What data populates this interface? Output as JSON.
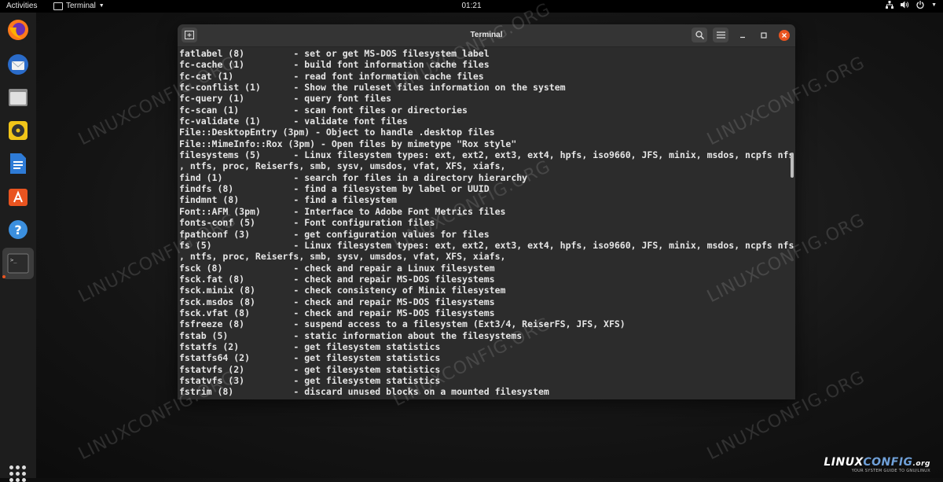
{
  "topbar": {
    "activities": "Activities",
    "app_menu": "Terminal",
    "clock": "01:21"
  },
  "dock": {
    "items": [
      "firefox-icon",
      "thunderbird-icon",
      "files-icon",
      "rhythmbox-icon",
      "writer-icon",
      "software-icon",
      "help-icon",
      "terminal-icon"
    ],
    "accent": "#e95420"
  },
  "window": {
    "title": "Terminal",
    "lines": [
      "fatlabel (8)         - set or get MS-DOS filesystem label",
      "fc-cache (1)         - build font information cache files",
      "fc-cat (1)           - read font information cache files",
      "fc-conflist (1)      - Show the ruleset files information on the system",
      "fc-query (1)         - query font files",
      "fc-scan (1)          - scan font files or directories",
      "fc-validate (1)      - validate font files",
      "File::DesktopEntry (3pm) - Object to handle .desktop files",
      "File::MimeInfo::Rox (3pm) - Open files by mimetype \"Rox style\"",
      "filesystems (5)      - Linux filesystem types: ext, ext2, ext3, ext4, hpfs, iso9660, JFS, minix, msdos, ncpfs nfs",
      ", ntfs, proc, Reiserfs, smb, sysv, umsdos, vfat, XFS, xiafs,",
      "find (1)             - search for files in a directory hierarchy",
      "findfs (8)           - find a filesystem by label or UUID",
      "findmnt (8)          - find a filesystem",
      "Font::AFM (3pm)      - Interface to Adobe Font Metrics files",
      "fonts-conf (5)       - Font configuration files",
      "fpathconf (3)        - get configuration values for files",
      "fs (5)               - Linux filesystem types: ext, ext2, ext3, ext4, hpfs, iso9660, JFS, minix, msdos, ncpfs nfs",
      ", ntfs, proc, Reiserfs, smb, sysv, umsdos, vfat, XFS, xiafs,",
      "fsck (8)             - check and repair a Linux filesystem",
      "fsck.fat (8)         - check and repair MS-DOS filesystems",
      "fsck.minix (8)       - check consistency of Minix filesystem",
      "fsck.msdos (8)       - check and repair MS-DOS filesystems",
      "fsck.vfat (8)        - check and repair MS-DOS filesystems",
      "fsfreeze (8)         - suspend access to a filesystem (Ext3/4, ReiserFS, JFS, XFS)",
      "fstab (5)            - static information about the filesystems",
      "fstatfs (2)          - get filesystem statistics",
      "fstatfs64 (2)        - get filesystem statistics",
      "fstatvfs (2)         - get filesystem statistics",
      "fstatvfs (3)         - get filesystem statistics",
      "fstrim (8)           - discard unused blocks on a mounted filesystem"
    ]
  },
  "watermark": "LINUXCONFIG.ORG",
  "logo": {
    "name_a": "LINUX",
    "name_b": "CONFIG",
    "suffix": ".org",
    "tagline": "YOUR SYSTEM GUIDE TO GNU/LINUX"
  }
}
